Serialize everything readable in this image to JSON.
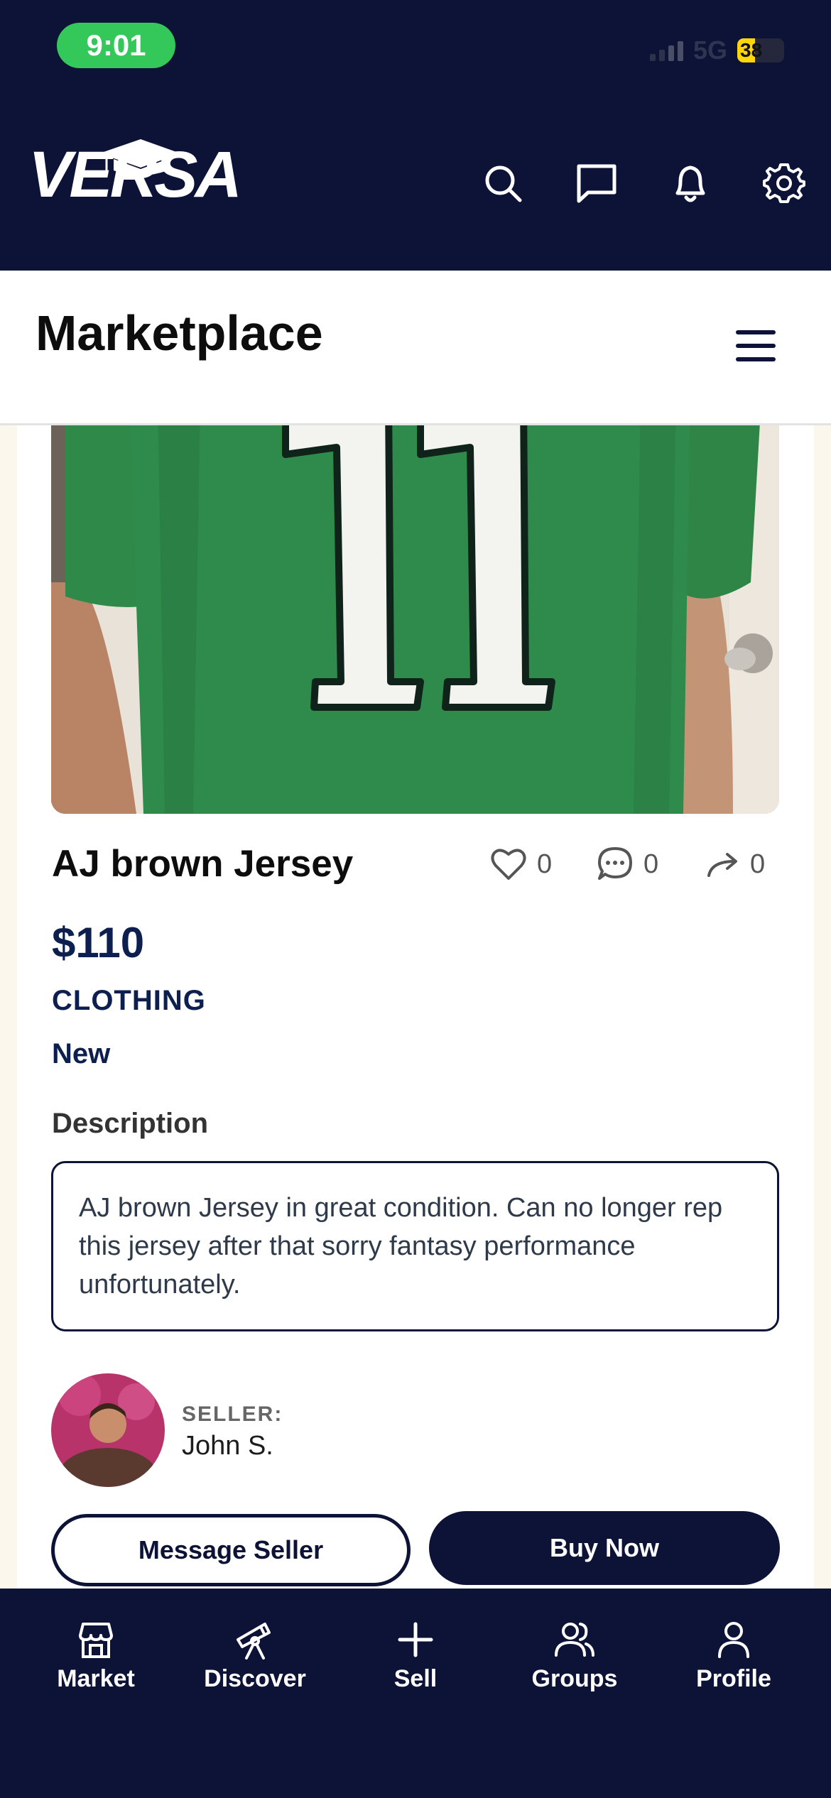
{
  "status_bar": {
    "time": "9:01",
    "network": "5G",
    "battery": "38",
    "battery_level": 0.38
  },
  "header": {
    "logo_text": "VERSA",
    "icons": [
      "search-icon",
      "chat-icon",
      "bell-icon",
      "gear-icon"
    ]
  },
  "page": {
    "title": "Marketplace"
  },
  "listing": {
    "image_subject": "green jersey number 11",
    "title": "AJ brown Jersey",
    "likes": "0",
    "comments": "0",
    "shares": "0",
    "price": "$110",
    "category": "CLOTHING",
    "condition": "New",
    "description_label": "Description",
    "description": "AJ brown Jersey in great condition. Can no longer rep this jersey after that sorry fantasy performance unfortunately."
  },
  "seller": {
    "label": "SELLER:",
    "name": "John S."
  },
  "actions": {
    "message_label": "Message Seller",
    "buy_label": "Buy Now"
  },
  "bottom_nav": {
    "items": [
      {
        "label": "Market",
        "icon": "store-icon"
      },
      {
        "label": "Discover",
        "icon": "telescope-icon"
      },
      {
        "label": "Sell",
        "icon": "plus-icon"
      },
      {
        "label": "Groups",
        "icon": "users-icon"
      },
      {
        "label": "Profile",
        "icon": "user-icon"
      }
    ]
  },
  "colors": {
    "navy": "#0c1336",
    "status_green": "#34c759",
    "jersey_green": "#2f8a4a",
    "battery_yellow": "#ffd60a"
  }
}
